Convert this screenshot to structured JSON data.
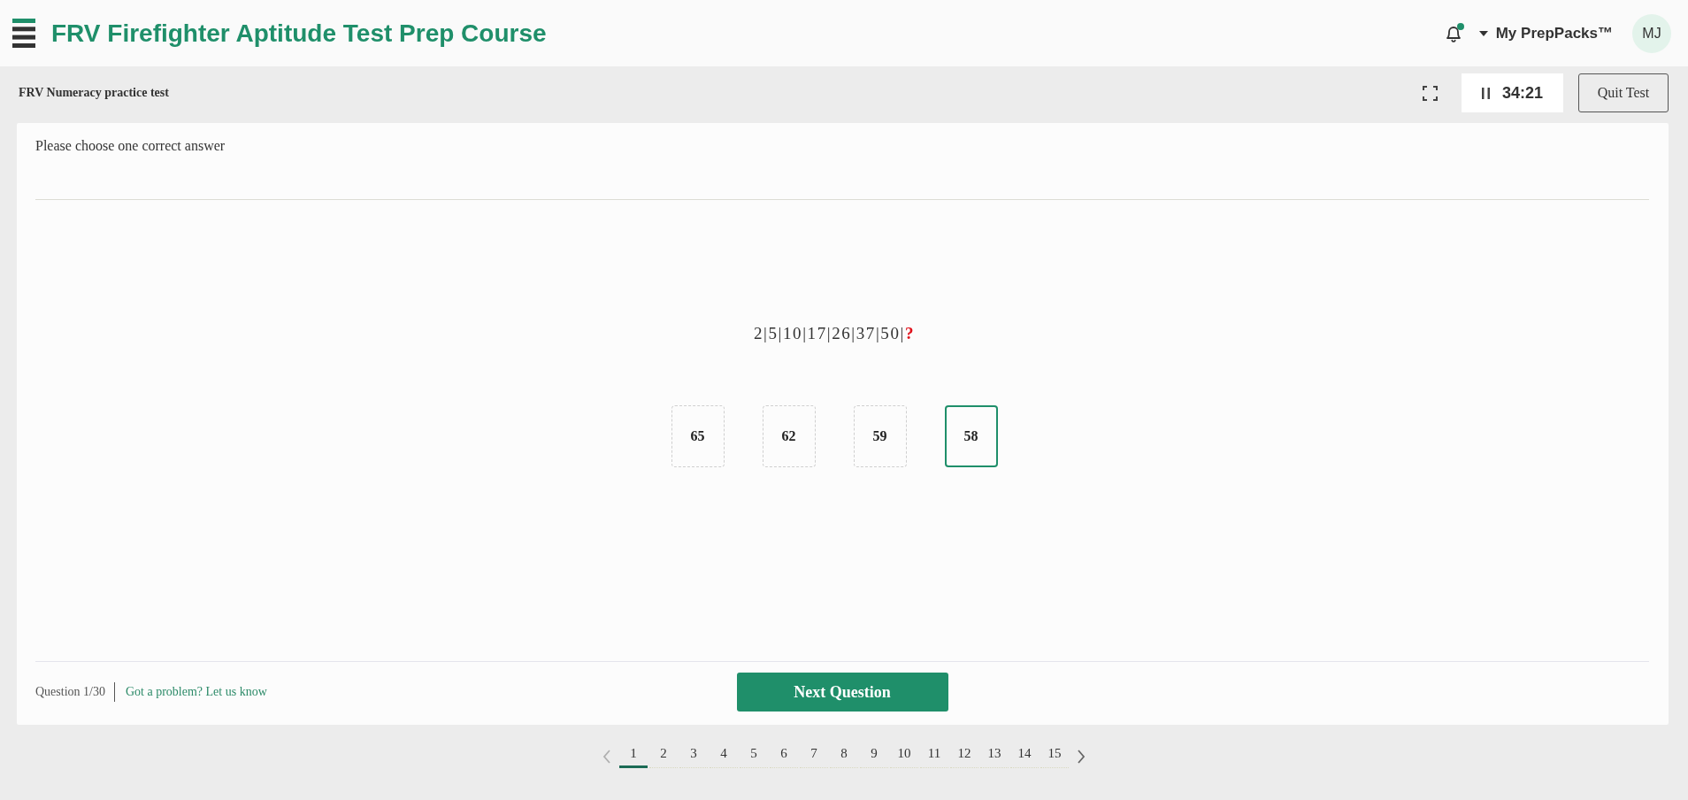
{
  "header": {
    "title": "FRV Firefighter Aptitude Test Prep Course",
    "has_notifications": true,
    "menu_label": "My PrepPacks™",
    "avatar_initials": "MJ"
  },
  "test_bar": {
    "title": "FRV Numeracy practice test",
    "timer": "34:21",
    "quit_button": "Quit Test"
  },
  "question": {
    "instruction": "Please choose one correct answer",
    "sequence": {
      "terms": "2|5|10|17|26|37|50|",
      "unknown": "?"
    },
    "answers": [
      {
        "label": "65",
        "selected": false
      },
      {
        "label": "62",
        "selected": false
      },
      {
        "label": "59",
        "selected": false
      },
      {
        "label": "58",
        "selected": true
      }
    ]
  },
  "footer": {
    "counter": "Question 1/30",
    "report_link": "Got a problem? Let us know",
    "next_button": "Next Question"
  },
  "pagination": {
    "prev_disabled": true,
    "next_disabled": false,
    "pages": [
      {
        "label": "1",
        "selected": true
      },
      {
        "label": "2",
        "selected": false
      },
      {
        "label": "3",
        "selected": false
      },
      {
        "label": "4",
        "selected": false
      },
      {
        "label": "5",
        "selected": false
      },
      {
        "label": "6",
        "selected": false
      },
      {
        "label": "7",
        "selected": false
      },
      {
        "label": "8",
        "selected": false
      },
      {
        "label": "9",
        "selected": false
      },
      {
        "label": "10",
        "selected": false
      },
      {
        "label": "11",
        "selected": false
      },
      {
        "label": "12",
        "selected": false
      },
      {
        "label": "13",
        "selected": false
      },
      {
        "label": "14",
        "selected": false
      },
      {
        "label": "15",
        "selected": false
      }
    ]
  }
}
